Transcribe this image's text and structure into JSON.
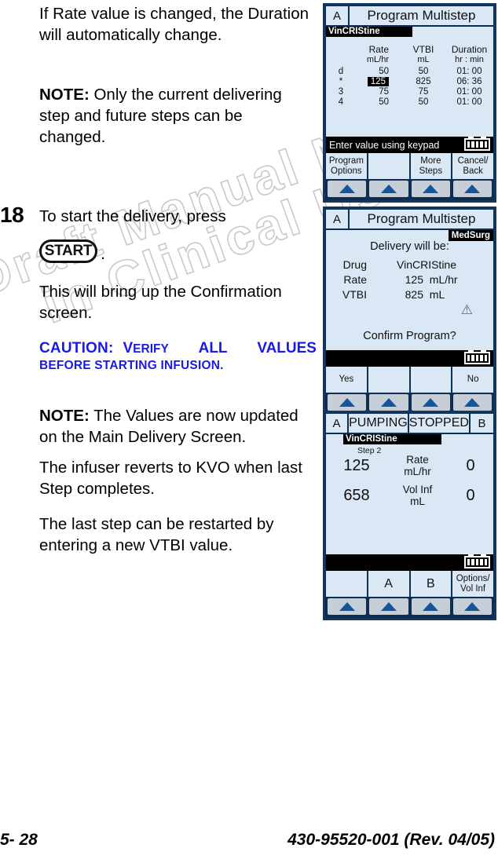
{
  "watermark": {
    "line1": "Draft Manual Not",
    "line2": "in Clinical Use"
  },
  "body": {
    "p1": "If Rate value is changed, the Duration will automatically change.",
    "note1_label": "NOTE:",
    "note1_text": " Only the current delivering step and future steps can be changed.",
    "step_number": "18",
    "step_intro": "To start the delivery, press",
    "start_key": "START",
    "start_period": ".",
    "p2": "This will bring up the Confirmation screen.",
    "caution_head": "CAUTION:",
    "caution_v": "V",
    "caution_erify": "ERIFY",
    "caution_all": "ALL",
    "caution_values": "VALUES",
    "caution_line2": "BEFORE STARTING INFUSION.",
    "note2_label": "NOTE:",
    "note2_text": " The Values are now updated on the Main Delivery Screen.",
    "p3": "The infuser reverts to KVO when last Step completes.",
    "p4": "The last step can be restarted by entering a new VTBI value."
  },
  "screen1": {
    "channel": "A",
    "title": "Program Multistep",
    "drug": "VinCRIStine",
    "table": {
      "headers_row1": [
        "Rate",
        "VTBI",
        "Duration"
      ],
      "headers_row2": [
        "mL/hr",
        "mL",
        "hr : min"
      ],
      "rows": [
        {
          "label": "d",
          "rate": "50",
          "vtbi": "50",
          "duration": "01: 00",
          "selected": false
        },
        {
          "label": "*",
          "rate": "125",
          "vtbi": "825",
          "duration": "06: 36",
          "selected": true
        },
        {
          "label": "3",
          "rate": "75",
          "vtbi": "75",
          "duration": "01: 00",
          "selected": false
        },
        {
          "label": "4",
          "rate": "50",
          "vtbi": "50",
          "duration": "01: 00",
          "selected": false
        }
      ]
    },
    "status": "Enter value using keypad",
    "softkeys": [
      "Program\nOptions",
      "",
      "More\nSteps",
      "Cancel/\nBack"
    ],
    "softkey1_l1": "Program",
    "softkey1_l2": "Options",
    "softkey2_l1": "",
    "softkey2_l2": "",
    "softkey3_l1": "More",
    "softkey3_l2": "Steps",
    "softkey4_l1": "Cancel/",
    "softkey4_l2": "Back"
  },
  "screen2": {
    "channel": "A",
    "title": "Program Multistep",
    "badge": "MedSurg",
    "heading": "Delivery will be:",
    "rows": [
      {
        "key": "Drug",
        "value": "VinCRIStine",
        "unit": ""
      },
      {
        "key": "Rate",
        "value": "125",
        "unit": "mL/hr"
      },
      {
        "key": "VTBI",
        "value": "825",
        "unit": "mL"
      }
    ],
    "warning_icon": "warning-triangle",
    "question": "Confirm Program?",
    "status": "",
    "softkey1": "Yes",
    "softkey2": "",
    "softkey3": "",
    "softkey4": "No"
  },
  "screen3": {
    "channel_a": "A",
    "status_a": "PUMPING",
    "status_b": "STOPPED",
    "channel_b": "B",
    "drug": "VinCRIStine",
    "step": "Step 2",
    "rows": [
      {
        "left": "125",
        "label_l1": "Rate",
        "label_l2": "mL/hr",
        "right": "0"
      },
      {
        "left": "658",
        "label_l1": "Vol Inf",
        "label_l2": "mL",
        "right": "0"
      }
    ],
    "status": "",
    "softkey1_l1": "",
    "softkey1_l2": "",
    "softkey2_l1": "A",
    "softkey2_l2": "",
    "softkey3_l1": "B",
    "softkey3_l2": "",
    "softkey4_l1": "Options/",
    "softkey4_l2": "Vol Inf"
  },
  "footer": {
    "page": "5- 28",
    "docnum": "430-95520-001 (Rev. 04/05)"
  },
  "colors": {
    "device_frame": "#12365f",
    "screen_bg": "#d9e8f4",
    "accent_blue": "#15559c",
    "caution_blue": "#1a1ae6",
    "banner_black": "#000000"
  }
}
